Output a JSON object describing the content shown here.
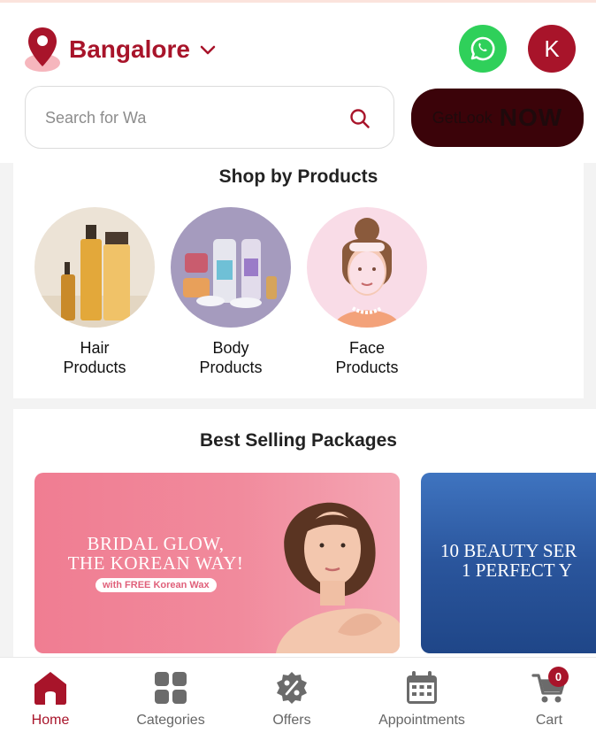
{
  "header": {
    "location": {
      "city": "Bangalore"
    },
    "profile": {
      "initial": "K"
    },
    "search": {
      "placeholder": "Search for Wa"
    },
    "promo": {
      "brand": "GetLook",
      "suffix": "NOW"
    }
  },
  "shop_by_products": {
    "title": "Shop by Products",
    "items": [
      {
        "line1": "Hair",
        "line2": "Products"
      },
      {
        "line1": "Body",
        "line2": "Products"
      },
      {
        "line1": "Face",
        "line2": "Products"
      }
    ]
  },
  "best_selling": {
    "title": "Best Selling Packages",
    "banners": [
      {
        "line1": "BRIDAL GLOW,",
        "line2": "THE KOREAN WAY!",
        "tag": "with FREE Korean Wax"
      },
      {
        "line1": "10 BEAUTY SER",
        "line2": "1 PERFECT Y"
      }
    ]
  },
  "bottom_nav": {
    "items": [
      {
        "label": "Home",
        "icon": "home-icon",
        "active": true
      },
      {
        "label": "Categories",
        "icon": "grid-icon"
      },
      {
        "label": "Offers",
        "icon": "percent-badge-icon"
      },
      {
        "label": "Appointments",
        "icon": "calendar-icon"
      },
      {
        "label": "Cart",
        "icon": "cart-icon"
      }
    ],
    "cart_count": "0"
  },
  "colors": {
    "brand": "#a8142a",
    "whatsapp": "#2fd05a",
    "promo_bg": "#3b0309"
  }
}
